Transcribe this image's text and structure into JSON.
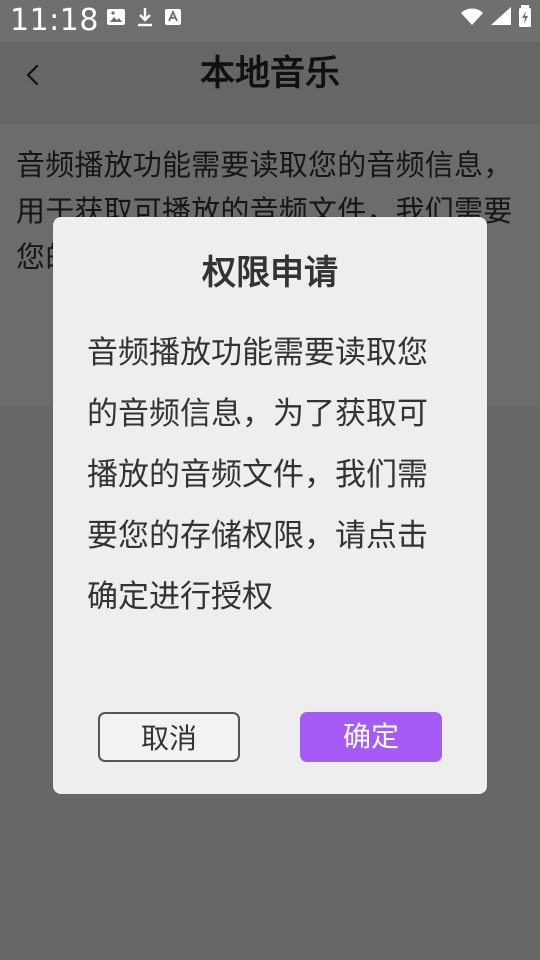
{
  "status_bar": {
    "time": "11:18",
    "icons": {
      "left": [
        "image-icon",
        "download-icon",
        "app-icon"
      ],
      "right": [
        "wifi-icon",
        "signal-icon",
        "battery-icon"
      ]
    },
    "text_color": "#ffffff"
  },
  "header": {
    "back_icon": "chevron-left-icon",
    "title": "本地音乐"
  },
  "background_text": {
    "content": "音频播放功能需要读取您的音频信息，用于获取可播放的音频文件，我们需要您的存储权限，请点击确定进行授权"
  },
  "dialog": {
    "title": "权限申请",
    "message": "音频播放功能需要读取您的音频信息，为了获取可播放的音频文件，我们需要您的存储权限，请点击确定进行授权",
    "cancel_label": "取消",
    "confirm_label": "确定",
    "colors": {
      "background": "#efeeee",
      "text": "#333333",
      "cancel_border": "#555555",
      "confirm_background": "#a55cf7",
      "confirm_text": "#ffffff"
    }
  },
  "page_colors": {
    "overlay": "#676767"
  }
}
